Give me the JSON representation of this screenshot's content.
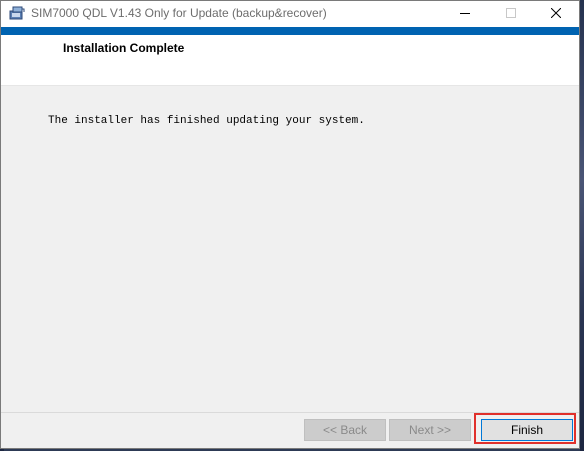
{
  "window": {
    "title": "SIM7000 QDL V1.43 Only for Update (backup&recover)",
    "controls": {
      "minimize": "minimize-icon",
      "maximize": "maximize-icon",
      "close": "close-icon"
    }
  },
  "header": {
    "title": "Installation Complete"
  },
  "body": {
    "message": "The installer has finished updating your system."
  },
  "buttons": {
    "back_label": "<< Back",
    "next_label": "Next >>",
    "finish_label": "Finish"
  },
  "colors": {
    "accent": "#0063b1",
    "highlight": "#e0302b"
  }
}
